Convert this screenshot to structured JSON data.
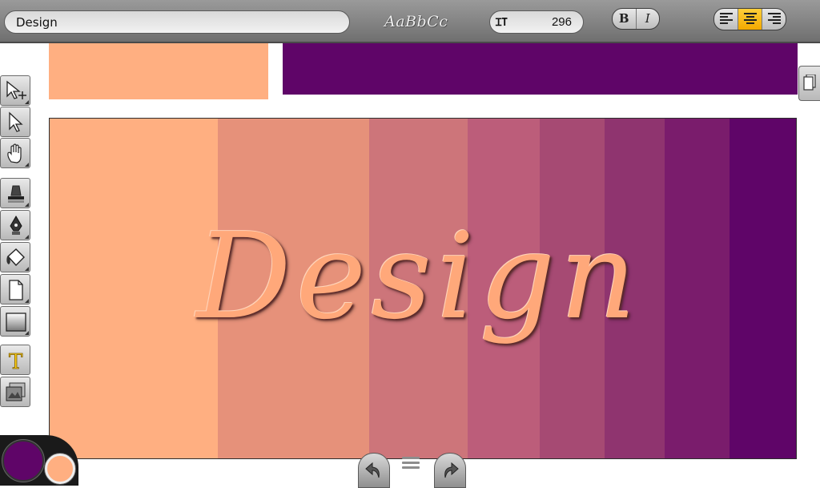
{
  "toolbar": {
    "text_value": "Design",
    "font_preview": "AaBbCc",
    "size_icon": "ꞮT",
    "font_size": "296",
    "style_buttons": [
      {
        "label": "B",
        "icon": "bold"
      },
      {
        "label": "I",
        "icon": "italic"
      }
    ],
    "align_buttons": [
      {
        "icon": "align-left-icon",
        "active": false
      },
      {
        "icon": "align-center-icon",
        "active": true
      },
      {
        "icon": "align-right-icon",
        "active": false
      }
    ]
  },
  "canvas": {
    "text": "Design",
    "text_color": "#ffa87a",
    "top_swatches": [
      "#ffaf81",
      "#5f0568"
    ],
    "stripes": [
      {
        "color": "#ffaf81"
      },
      {
        "color": "#e6917a"
      },
      {
        "color": "#cd757a"
      },
      {
        "color": "#bc5d7a"
      },
      {
        "color": "#a64a73"
      },
      {
        "color": "#8f346f"
      },
      {
        "color": "#7a1c6c"
      },
      {
        "color": "#5f0568"
      }
    ]
  },
  "tools": [
    "move-transform-icon",
    "select-arrow-icon",
    "hand-pan-icon",
    "fill-stamp-icon",
    "pen-nib-icon",
    "paint-bucket-icon",
    "new-page-icon",
    "gradient-rect-icon",
    "text-tool-icon",
    "image-import-icon"
  ],
  "colors": {
    "primary": "#5f0568",
    "secondary": "#ffaf81"
  }
}
